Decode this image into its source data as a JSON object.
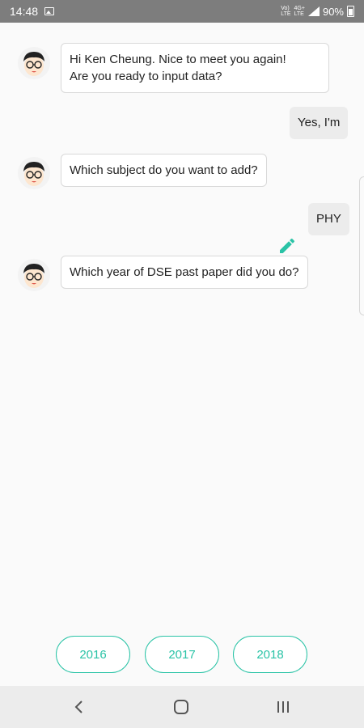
{
  "status_bar": {
    "time": "14:48",
    "net_top": "Vo)",
    "net_bottom": "LTE",
    "net2_top": "4G+",
    "net2_bottom": "LTE",
    "battery": "90%",
    "icons": [
      "image-icon",
      "signal-icon",
      "battery-icon"
    ]
  },
  "messages": [
    {
      "from": "bot",
      "lines": [
        "Hi Ken Cheung. Nice to meet you again!",
        "Are you ready to input data?"
      ]
    },
    {
      "from": "user",
      "text": "Yes, I'm"
    },
    {
      "from": "bot",
      "lines": [
        "Which subject do you want to add?"
      ]
    },
    {
      "from": "user",
      "text": "PHY",
      "editable": true
    },
    {
      "from": "bot",
      "lines": [
        "Which year of DSE past paper did you do?"
      ]
    }
  ],
  "options": [
    "2016",
    "2017",
    "2018"
  ],
  "nav": {
    "icons": [
      "back-icon",
      "home-icon",
      "recents-icon"
    ]
  },
  "colors": {
    "accent": "#2ac3a6",
    "status_bar": "#7d7d7d",
    "nav_bar": "#ececec",
    "background": "#fafafa"
  }
}
